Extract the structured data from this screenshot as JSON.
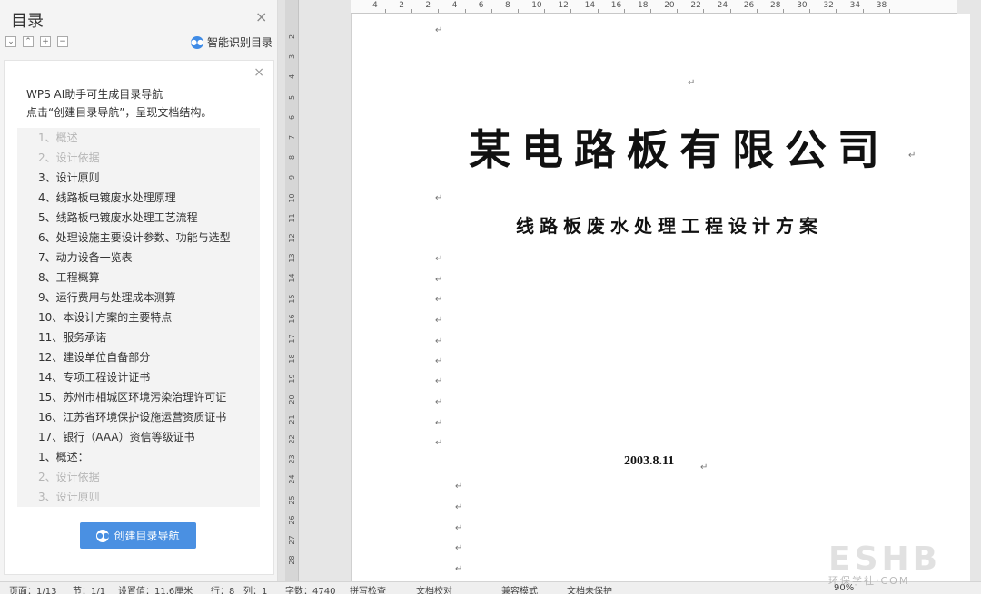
{
  "toc_pane": {
    "title": "目录",
    "close": "×",
    "smart_label": "智能识别目录"
  },
  "ai_card": {
    "close": "×",
    "line1": "WPS AI助手可生成目录导航",
    "line2": "点击“创建目录导航”，呈现文档结构。",
    "items": [
      {
        "text": "1、概述",
        "faded": true
      },
      {
        "text": "2、设计依据",
        "faded": true
      },
      {
        "text": "3、设计原则",
        "faded": false
      },
      {
        "text": "4、线路板电镀废水处理原理",
        "faded": false
      },
      {
        "text": "5、线路板电镀废水处理工艺流程",
        "faded": false
      },
      {
        "text": "6、处理设施主要设计参数、功能与选型",
        "faded": false
      },
      {
        "text": "7、动力设备一览表",
        "faded": false
      },
      {
        "text": "8、工程概算",
        "faded": false
      },
      {
        "text": "9、运行费用与处理成本测算",
        "faded": false
      },
      {
        "text": "10、本设计方案的主要特点",
        "faded": false
      },
      {
        "text": "11、服务承诺",
        "faded": false
      },
      {
        "text": "12、建设单位自备部分",
        "faded": false
      },
      {
        "text": "14、专项工程设计证书",
        "faded": false
      },
      {
        "text": "15、苏州市相城区环境污染治理许可证",
        "faded": false
      },
      {
        "text": "16、江苏省环境保护设施运营资质证书",
        "faded": false
      },
      {
        "text": "17、银行（AAA）资信等级证书",
        "faded": false
      },
      {
        "text": "1、概述：",
        "faded": false
      },
      {
        "text": "2、设计依据",
        "faded": true
      },
      {
        "text": "3、设计原则",
        "faded": true
      }
    ],
    "create_button": "创建目录导航"
  },
  "ruler": {
    "h_labels": [
      "4",
      "2",
      "2",
      "4",
      "6",
      "8",
      "10",
      "12",
      "14",
      "16",
      "18",
      "20",
      "22",
      "24",
      "26",
      "28",
      "30",
      "32",
      "34",
      "38"
    ],
    "v_labels": [
      "2",
      "3",
      "4",
      "5",
      "6",
      "7",
      "8",
      "9",
      "10",
      "11",
      "12",
      "13",
      "14",
      "15",
      "16",
      "17",
      "18",
      "19",
      "20",
      "21",
      "22",
      "23",
      "24",
      "25",
      "26",
      "27",
      "28"
    ]
  },
  "document": {
    "company": "某电路板有限公司",
    "subtitle": "线路板废水处理工程设计方案",
    "date": "2003.8.11",
    "para_mark": "↵"
  },
  "status_bar": {
    "page": "页面：1/13",
    "section": "节：1/1",
    "position": "设置值：11.6厘米",
    "row": "行：8",
    "col": "列：1",
    "words": "字数：4740",
    "spell": "拼写检查",
    "proof": "文档校对",
    "compat": "兼容模式",
    "protect": "文档未保护",
    "zoom": "90%"
  },
  "watermark": {
    "main": "ESHB",
    "sub": "环保学社·COM"
  }
}
